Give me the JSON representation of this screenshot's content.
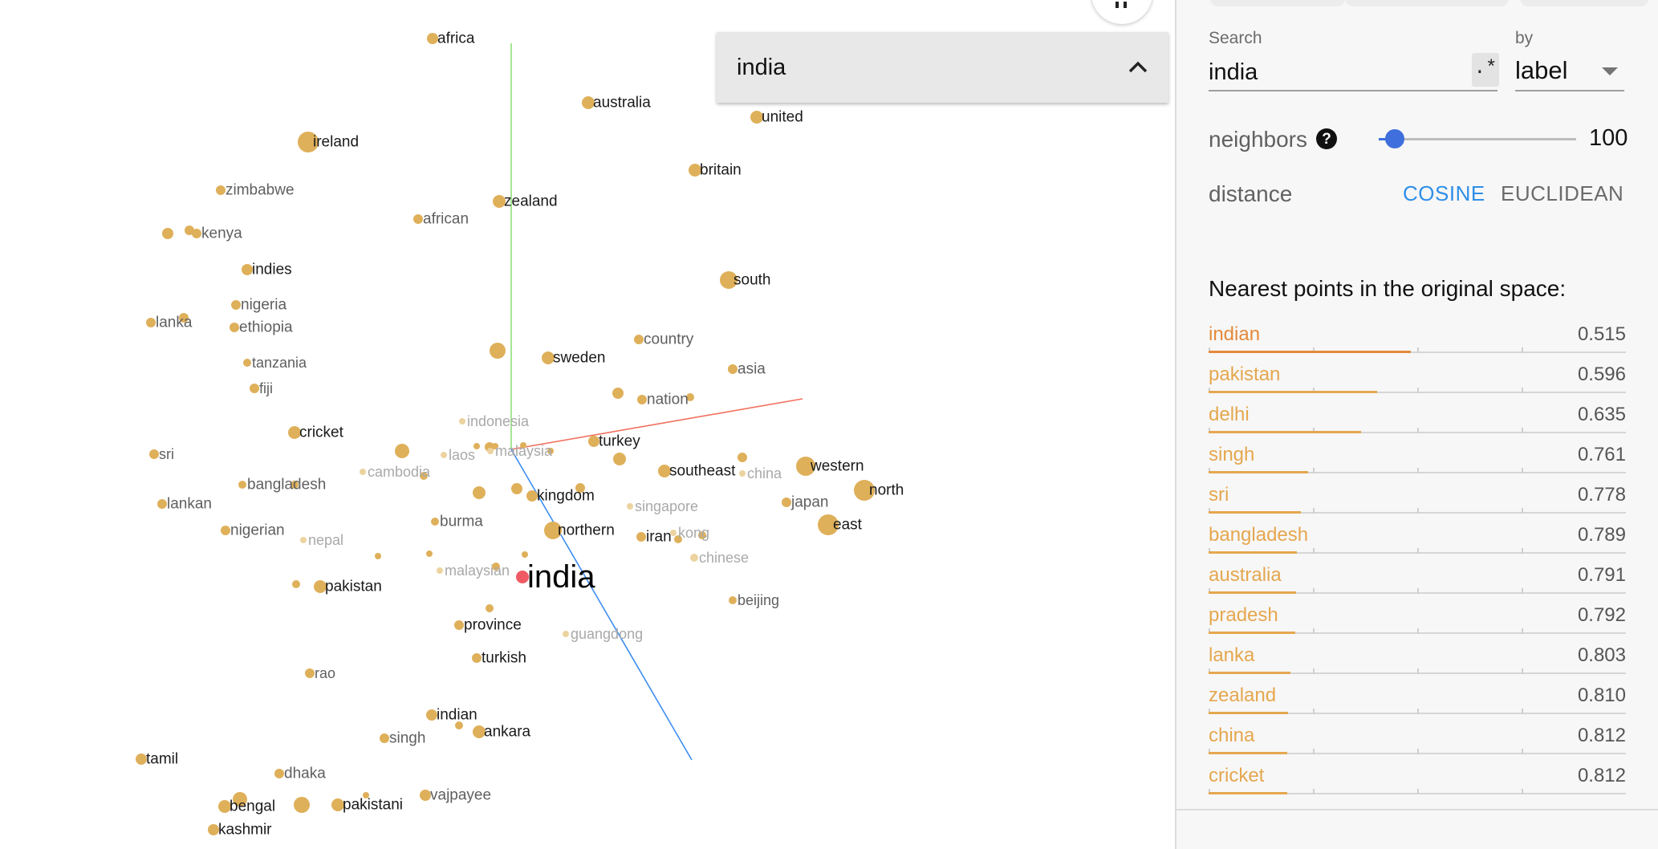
{
  "colors": {
    "point": "#dfb05a",
    "point_selected": "#f05a64",
    "point_faint": "#ecd39f",
    "neighbor_label": "#e5a74f",
    "neighbor_label_top": "#e48a3c",
    "accent_blue": "#2f8fe8",
    "slider_blue": "#3e6fdc",
    "axis_x": "#f2705e",
    "axis_y": "#8fe07a",
    "axis_z": "#3d8ef2"
  },
  "canvas": {
    "points": [
      {
        "label": "africa",
        "style": "on"
      },
      {
        "label": "australia",
        "style": "on"
      },
      {
        "label": "united",
        "style": "on"
      },
      {
        "label": "ireland",
        "style": "on"
      },
      {
        "label": "britain",
        "style": "on"
      },
      {
        "label": "zimbabwe",
        "style": "dim"
      },
      {
        "label": "zealand",
        "style": "on"
      },
      {
        "label": "african",
        "style": "dim"
      },
      {
        "label": "kenya",
        "style": "dim"
      },
      {
        "label": "indies",
        "style": "on"
      },
      {
        "label": "south",
        "style": "on"
      },
      {
        "label": "nigeria",
        "style": "dim"
      },
      {
        "label": "lanka",
        "style": "dim"
      },
      {
        "label": "ethiopia",
        "style": "dim"
      },
      {
        "label": "country",
        "style": "dim"
      },
      {
        "label": "sweden",
        "style": "on"
      },
      {
        "label": "tanzania",
        "style": "dim"
      },
      {
        "label": "asia",
        "style": "dim"
      },
      {
        "label": "fiji",
        "style": "dim"
      },
      {
        "label": "nation",
        "style": "dim"
      },
      {
        "label": "indonesia",
        "style": "faint"
      },
      {
        "label": "cricket",
        "style": "on"
      },
      {
        "label": "turkey",
        "style": "on"
      },
      {
        "label": "sri",
        "style": "dim"
      },
      {
        "label": "laos",
        "style": "faint"
      },
      {
        "label": "malaysia",
        "style": "faint"
      },
      {
        "label": "western",
        "style": "on"
      },
      {
        "label": "cambodia",
        "style": "faint"
      },
      {
        "label": "southeast",
        "style": "on"
      },
      {
        "label": "china",
        "style": "faint"
      },
      {
        "label": "bangladesh",
        "style": "dim"
      },
      {
        "label": "north",
        "style": "on"
      },
      {
        "label": "kingdom",
        "style": "on"
      },
      {
        "label": "lankan",
        "style": "dim"
      },
      {
        "label": "japan",
        "style": "dim"
      },
      {
        "label": "singapore",
        "style": "faint"
      },
      {
        "label": "burma",
        "style": "dim"
      },
      {
        "label": "east",
        "style": "on"
      },
      {
        "label": "nigerian",
        "style": "dim"
      },
      {
        "label": "northern",
        "style": "on"
      },
      {
        "label": "nepal",
        "style": "faint"
      },
      {
        "label": "iran",
        "style": "on"
      },
      {
        "label": "kong",
        "style": "faint"
      },
      {
        "label": "chinese",
        "style": "faint"
      },
      {
        "label": "malaysian",
        "style": "faint"
      },
      {
        "label": "india",
        "style": "big"
      },
      {
        "label": "pakistan",
        "style": "on"
      },
      {
        "label": "beijing",
        "style": "dim"
      },
      {
        "label": "province",
        "style": "on"
      },
      {
        "label": "guangdong",
        "style": "faint"
      },
      {
        "label": "turkish",
        "style": "on"
      },
      {
        "label": "rao",
        "style": "dim"
      },
      {
        "label": "indian",
        "style": "on"
      },
      {
        "label": "ankara",
        "style": "on"
      },
      {
        "label": "singh",
        "style": "dim"
      },
      {
        "label": "tamil",
        "style": "on"
      },
      {
        "label": "dhaka",
        "style": "dim"
      },
      {
        "label": "vajpayee",
        "style": "dim"
      },
      {
        "label": "bengal",
        "style": "on"
      },
      {
        "label": "pakistani",
        "style": "on"
      },
      {
        "label": "kashmir",
        "style": "on"
      }
    ]
  },
  "search_card": {
    "query": "india",
    "collapse_icon": "chevron-up-icon"
  },
  "panel": {
    "search_label": "Search",
    "search_value": "india",
    "regex_label": ".*",
    "by_label": "by",
    "by_value": "label",
    "neighbors_label": "neighbors",
    "neighbors_value": "100",
    "neighbors_fraction": 0.08,
    "help_icon": "?",
    "distance_label": "distance",
    "distance_options": [
      "COSINE",
      "EUCLIDEAN"
    ],
    "distance_selected": "COSINE",
    "nearest_title": "Nearest points in the original space:",
    "nearest": [
      {
        "label": "indian",
        "value": "0.515"
      },
      {
        "label": "pakistan",
        "value": "0.596"
      },
      {
        "label": "delhi",
        "value": "0.635"
      },
      {
        "label": "singh",
        "value": "0.761"
      },
      {
        "label": "sri",
        "value": "0.778"
      },
      {
        "label": "bangladesh",
        "value": "0.789"
      },
      {
        "label": "australia",
        "value": "0.791"
      },
      {
        "label": "pradesh",
        "value": "0.792"
      },
      {
        "label": "lanka",
        "value": "0.803"
      },
      {
        "label": "zealand",
        "value": "0.810"
      },
      {
        "label": "china",
        "value": "0.812"
      },
      {
        "label": "cricket",
        "value": "0.812"
      }
    ]
  }
}
